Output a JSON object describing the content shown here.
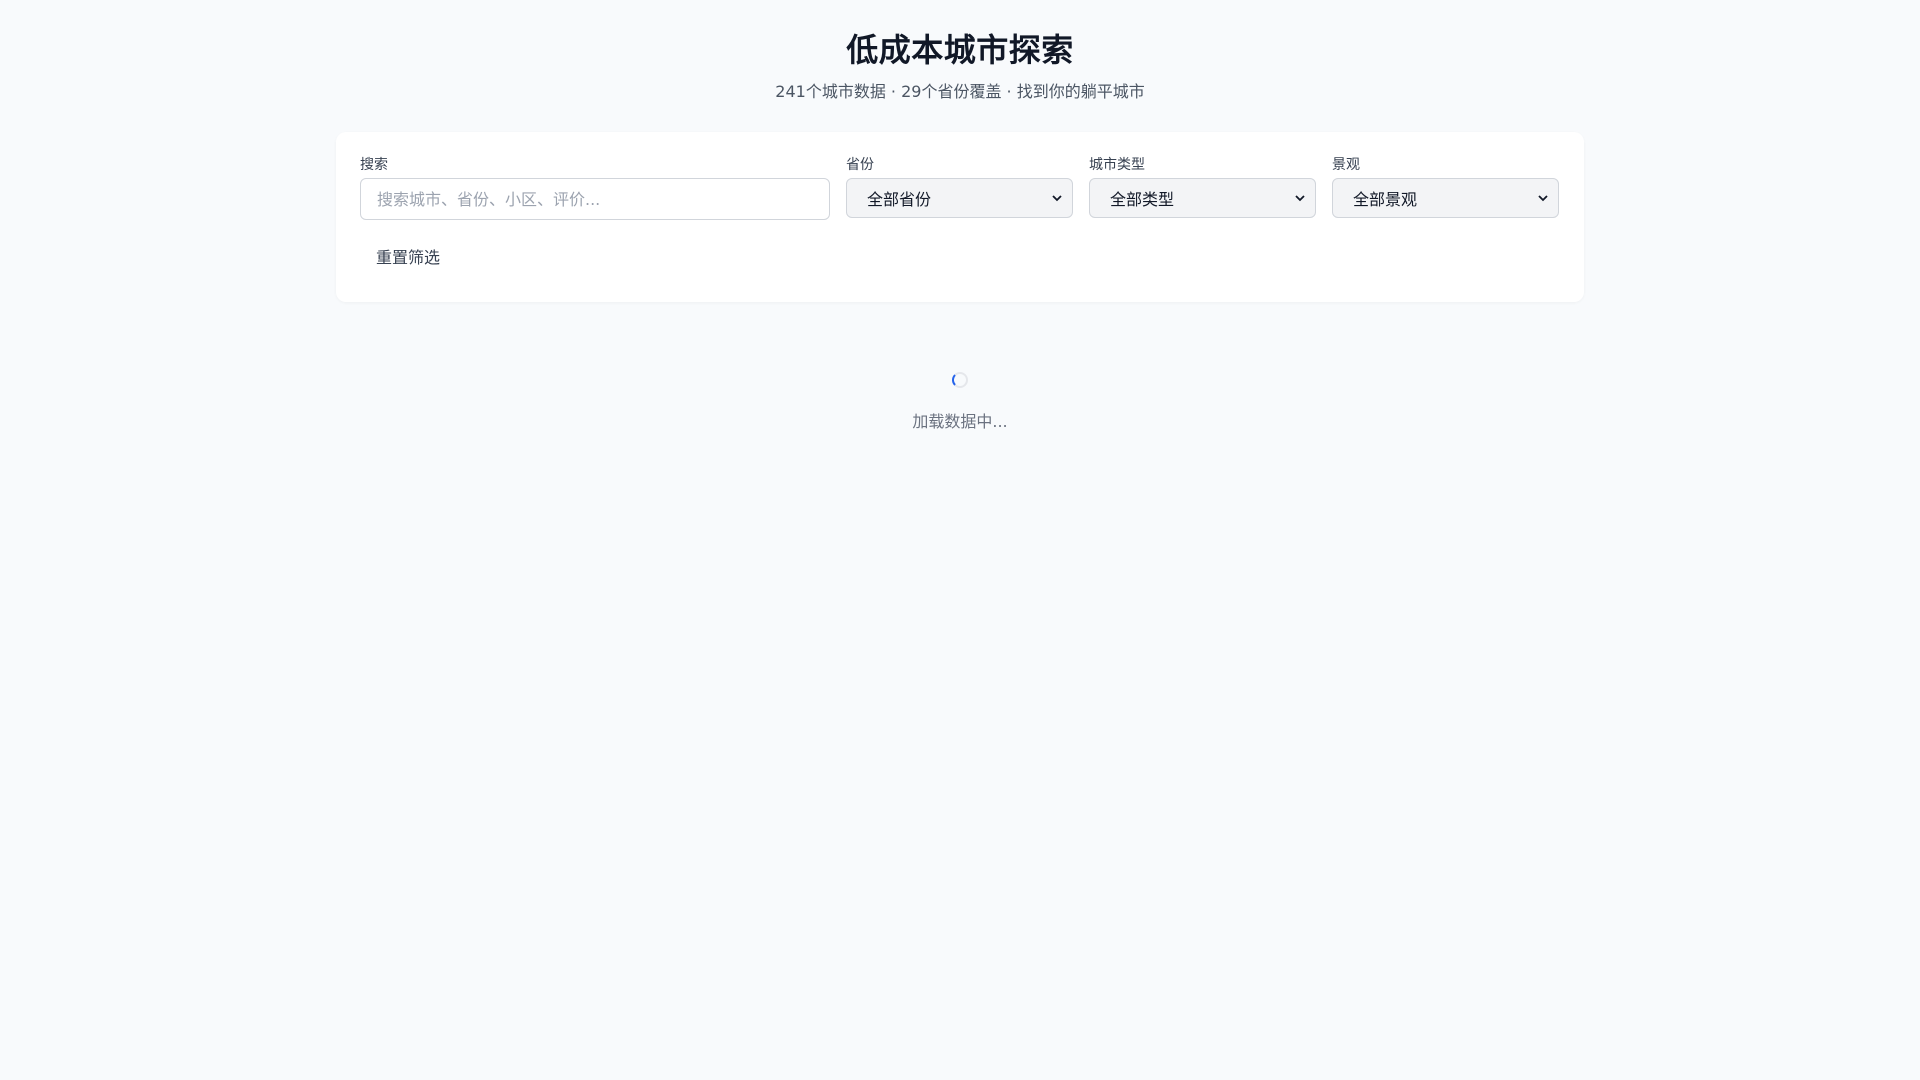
{
  "header": {
    "title": "低成本城市探索",
    "subtitle": "241个城市数据 · 29个省份覆盖 · 找到你的躺平城市"
  },
  "filters": {
    "search": {
      "label": "搜索",
      "placeholder": "搜索城市、省份、小区、评价...",
      "value": ""
    },
    "province": {
      "label": "省份",
      "selected": "全部省份",
      "icon": "chevron-down-icon"
    },
    "city_type": {
      "label": "城市类型",
      "selected": "全部类型",
      "icon": "chevron-down-icon"
    },
    "scenery": {
      "label": "景观",
      "selected": "全部景观",
      "icon": "chevron-down-icon"
    },
    "reset_label": "重置筛选"
  },
  "loading": {
    "text": "加载数据中...",
    "icon": "spinner-icon"
  },
  "colors": {
    "background": "#f8fafc",
    "card": "#ffffff",
    "accent": "#2563eb",
    "muted_text": "#6b7280"
  }
}
